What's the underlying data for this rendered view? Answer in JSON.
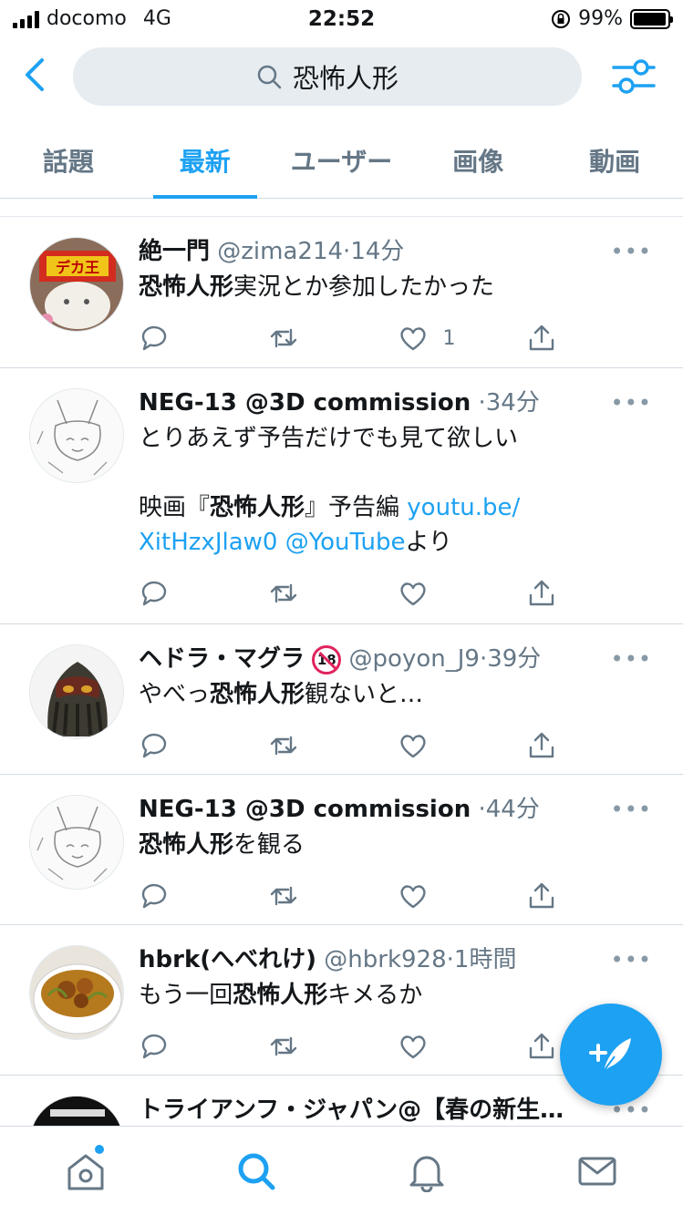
{
  "status_bar": {
    "carrier": "docomo",
    "network": "4G",
    "time": "22:52",
    "battery": "99%",
    "battery_level": 0.99
  },
  "search": {
    "query": "恐怖人形"
  },
  "tabs": [
    {
      "label": "話題",
      "active": false
    },
    {
      "label": "最新",
      "active": true
    },
    {
      "label": "ユーザー",
      "active": false
    },
    {
      "label": "画像",
      "active": false
    },
    {
      "label": "動画",
      "active": false
    }
  ],
  "tweets": [
    {
      "name": "絶一門",
      "handle": "@zima214",
      "time": "14分",
      "text": [
        {
          "b": "恐怖人形"
        },
        {
          "t": "実況とか参加したかった"
        }
      ],
      "likes": "1"
    },
    {
      "name": "NEG-13 @3D commission",
      "handle": "",
      "time": "34分",
      "text_lines": [
        "とりあえず予告だけでも見て欲しい",
        "",
        "映画『",
        "恐怖人形",
        "』予告編 ",
        "youtu.be/",
        "XitHzxJlaw0",
        " @YouTube",
        "より"
      ],
      "likes": ""
    },
    {
      "name": "ヘドラ・マグラ",
      "badge": "18",
      "handle": "@poyon_J9",
      "time": "39分",
      "text": [
        {
          "t": "やべっ"
        },
        {
          "b": "恐怖人形"
        },
        {
          "t": "観ないと…"
        }
      ],
      "likes": ""
    },
    {
      "name": "NEG-13 @3D commission",
      "handle": "",
      "time": "44分",
      "text": [
        {
          "b": "恐怖人形"
        },
        {
          "t": "を観る"
        }
      ],
      "likes": ""
    },
    {
      "name": "hbrk(へべれけ)",
      "handle": "@hbrk928",
      "time": "1時間",
      "text": [
        {
          "t": "もう一回"
        },
        {
          "b": "恐怖人形"
        },
        {
          "t": "キメるか"
        }
      ],
      "likes": ""
    },
    {
      "name": "トライアンフ・ジャパン@【春の新生…",
      "handle": "",
      "time": "",
      "text": [],
      "likes": ""
    }
  ],
  "separator": "·",
  "more_label": "•••",
  "colors": {
    "accent": "#1da1f2",
    "secondary_text": "#657786",
    "divider": "#d3dbe2"
  },
  "icons": {
    "nav": [
      "home-icon",
      "search-icon",
      "notifications-icon",
      "messages-icon"
    ],
    "actions": [
      "reply-icon",
      "retweet-icon",
      "like-icon",
      "share-icon"
    ]
  }
}
